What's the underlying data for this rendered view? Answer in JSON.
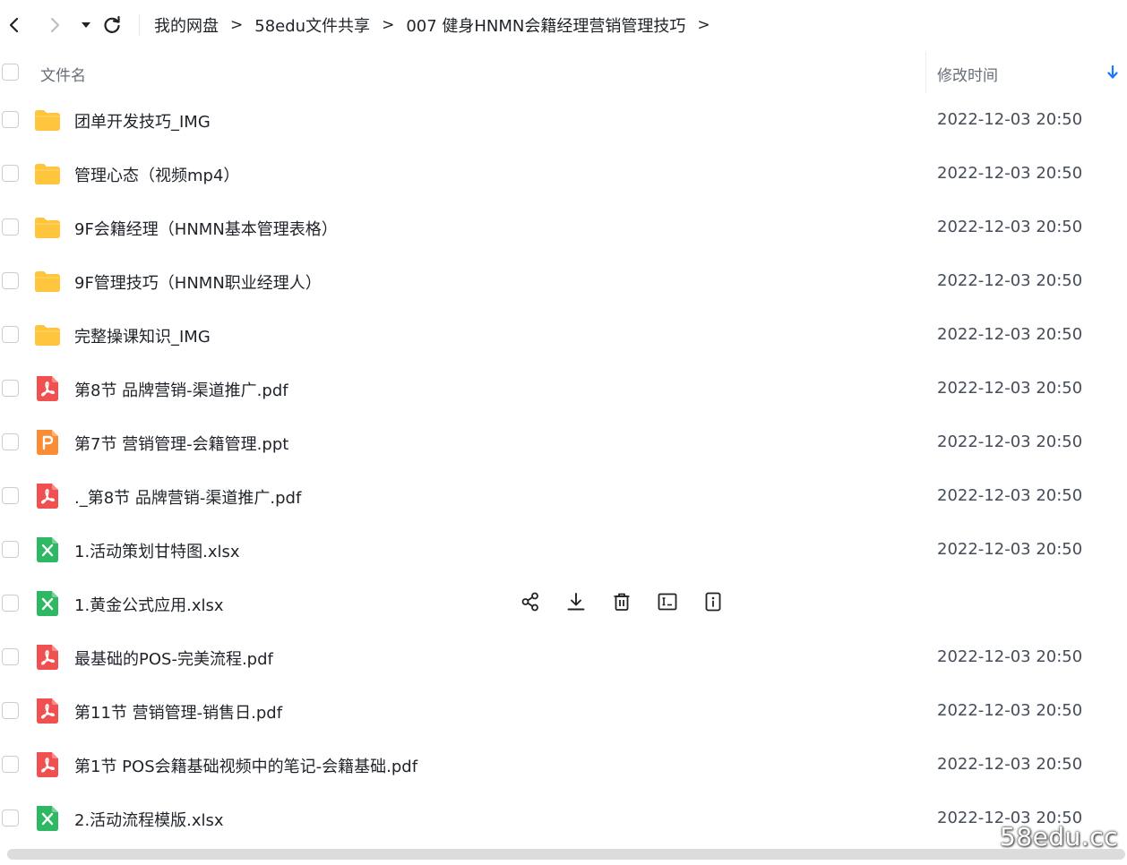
{
  "breadcrumb": {
    "items": [
      "我的网盘",
      "58edu文件共享",
      "007 健身HNMN会籍经理营销管理技巧"
    ],
    "separator": ">"
  },
  "table": {
    "col_name": "文件名",
    "col_time": "修改时间"
  },
  "rows": [
    {
      "name": "团单开发技巧_IMG",
      "time": "2022-12-03 20:50",
      "type": "folder"
    },
    {
      "name": "管理心态（视频mp4）",
      "time": "2022-12-03 20:50",
      "type": "folder"
    },
    {
      "name": "9F会籍经理（HNMN基本管理表格）",
      "time": "2022-12-03 20:50",
      "type": "folder"
    },
    {
      "name": "9F管理技巧（HNMN职业经理人）",
      "time": "2022-12-03 20:50",
      "type": "folder"
    },
    {
      "name": "完整操课知识_IMG",
      "time": "2022-12-03 20:50",
      "type": "folder"
    },
    {
      "name": "第8节   品牌营销-渠道推广.pdf",
      "time": "2022-12-03 20:50",
      "type": "pdf"
    },
    {
      "name": "第7节 营销管理-会籍管理.ppt",
      "time": "2022-12-03 20:50",
      "type": "ppt"
    },
    {
      "name": "._第8节   品牌营销-渠道推广.pdf",
      "time": "2022-12-03 20:50",
      "type": "pdf"
    },
    {
      "name": "1.活动策划甘特图.xlsx",
      "time": "2022-12-03 20:50",
      "type": "xlsx"
    },
    {
      "name": "1.黄金公式应用.xlsx",
      "time": "",
      "type": "xlsx",
      "hovered": true
    },
    {
      "name": "最基础的POS-完美流程.pdf",
      "time": "2022-12-03 20:50",
      "type": "pdf"
    },
    {
      "name": "第11节 营销管理-销售日.pdf",
      "time": "2022-12-03 20:50",
      "type": "pdf"
    },
    {
      "name": "第1节    POS会籍基础视频中的笔记-会籍基础.pdf",
      "time": "2022-12-03 20:50",
      "type": "pdf"
    },
    {
      "name": "2.活动流程模版.xlsx",
      "time": "2022-12-03 20:50",
      "type": "xlsx"
    }
  ],
  "row_actions": [
    "share-icon",
    "download-icon",
    "delete-icon",
    "rename-icon",
    "more-info-icon"
  ],
  "watermark": "58edu.cc",
  "colors": {
    "folder": "#ffc53d",
    "pdf": "#f0504f",
    "ppt": "#fa8c35",
    "xlsx": "#2fb864",
    "accent": "#1677ff"
  }
}
